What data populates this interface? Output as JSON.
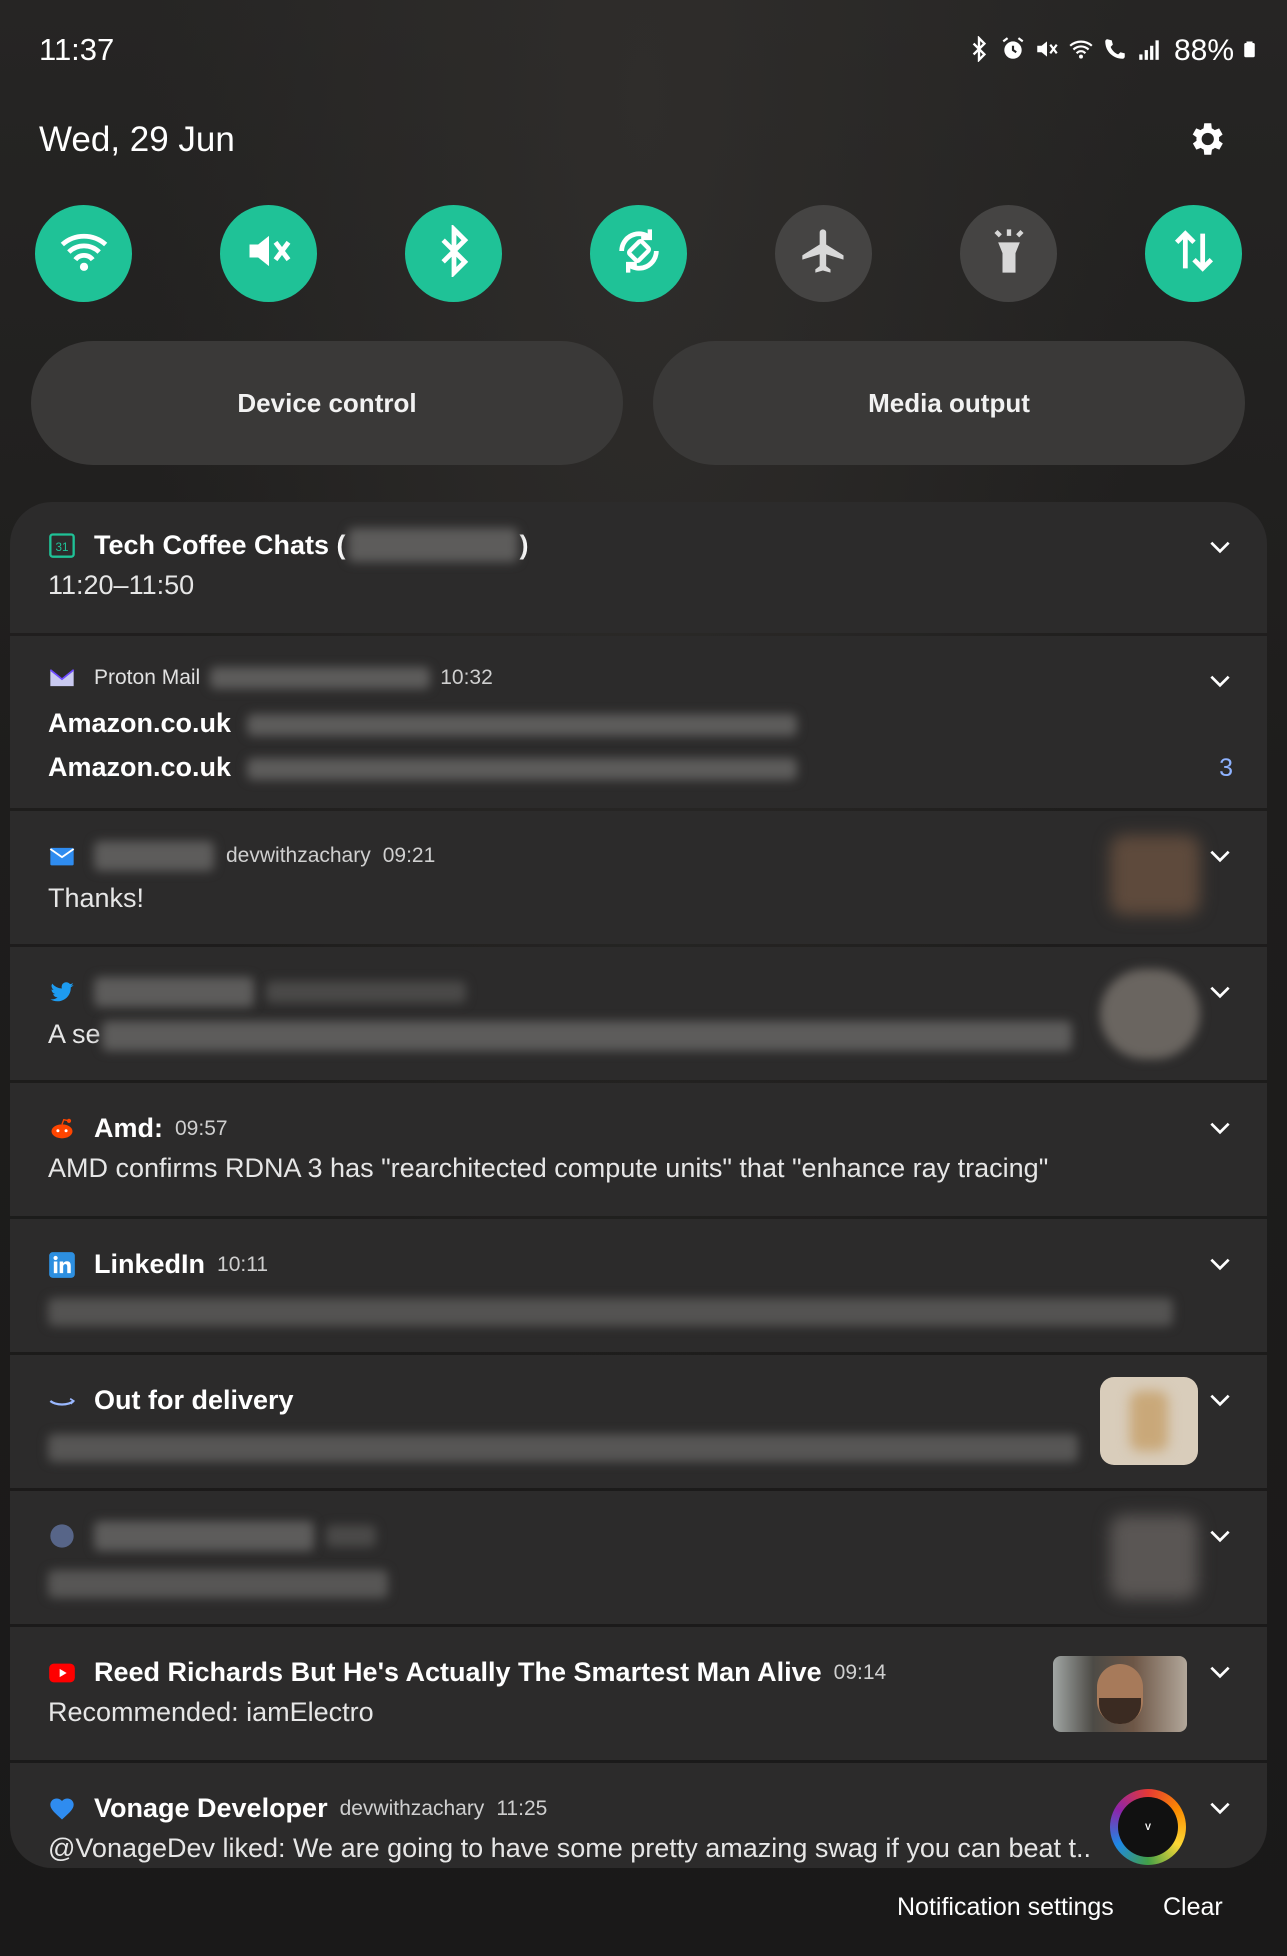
{
  "status": {
    "time": "11:37",
    "battery": "88%"
  },
  "header": {
    "date": "Wed, 29 Jun"
  },
  "quick_tiles": [
    {
      "name": "wifi",
      "icon": "wifi-icon",
      "state": "on"
    },
    {
      "name": "sound",
      "icon": "mute-icon",
      "state": "on"
    },
    {
      "name": "bluetooth",
      "icon": "bluetooth-icon",
      "state": "on"
    },
    {
      "name": "auto-rotate",
      "icon": "rotate-icon",
      "state": "on"
    },
    {
      "name": "airplane",
      "icon": "airplane-icon",
      "state": "off"
    },
    {
      "name": "torch",
      "icon": "flashlight-icon",
      "state": "off"
    },
    {
      "name": "mobile-data",
      "icon": "data-arrows-icon",
      "state": "on"
    }
  ],
  "pills": {
    "device_control": "Device control",
    "media_output": "Media output"
  },
  "notifications": {
    "calendar": {
      "title": "Tech Coffee Chats (",
      "title_end": ")",
      "body": "11:20–11:50"
    },
    "proton": {
      "app": "Proton Mail",
      "time": "10:32",
      "line1_sender": "Amazon.co.uk",
      "line2_sender": "Amazon.co.uk",
      "count": "3"
    },
    "mail": {
      "account": "devwithzachary",
      "time": "09:21",
      "body": "Thanks!"
    },
    "twitter": {
      "body_start": "A se"
    },
    "reddit": {
      "title": "Amd:",
      "time": "09:57",
      "body": "AMD confirms RDNA 3 has \"rearchitected compute units\" that \"enhance ray tracing\""
    },
    "linkedin": {
      "title": "LinkedIn",
      "time": "10:11"
    },
    "amazon": {
      "title": "Out for delivery"
    },
    "screenshot": {},
    "youtube": {
      "title": "Reed Richards But He's Actually The Smartest Man Alive",
      "time": "09:14",
      "body": "Recommended: iamElectro"
    },
    "vonage": {
      "title": "Vonage Developer",
      "account": "devwithzachary",
      "time": "11:25",
      "body": "@VonageDev liked: We are going to have some pretty amazing swag if you can beat t.."
    }
  },
  "footer": {
    "settings": "Notification settings",
    "clear": "Clear"
  },
  "colors": {
    "accent": "#1fc297",
    "tile_off": "#454443",
    "card_bg": "#2c2b2b"
  }
}
